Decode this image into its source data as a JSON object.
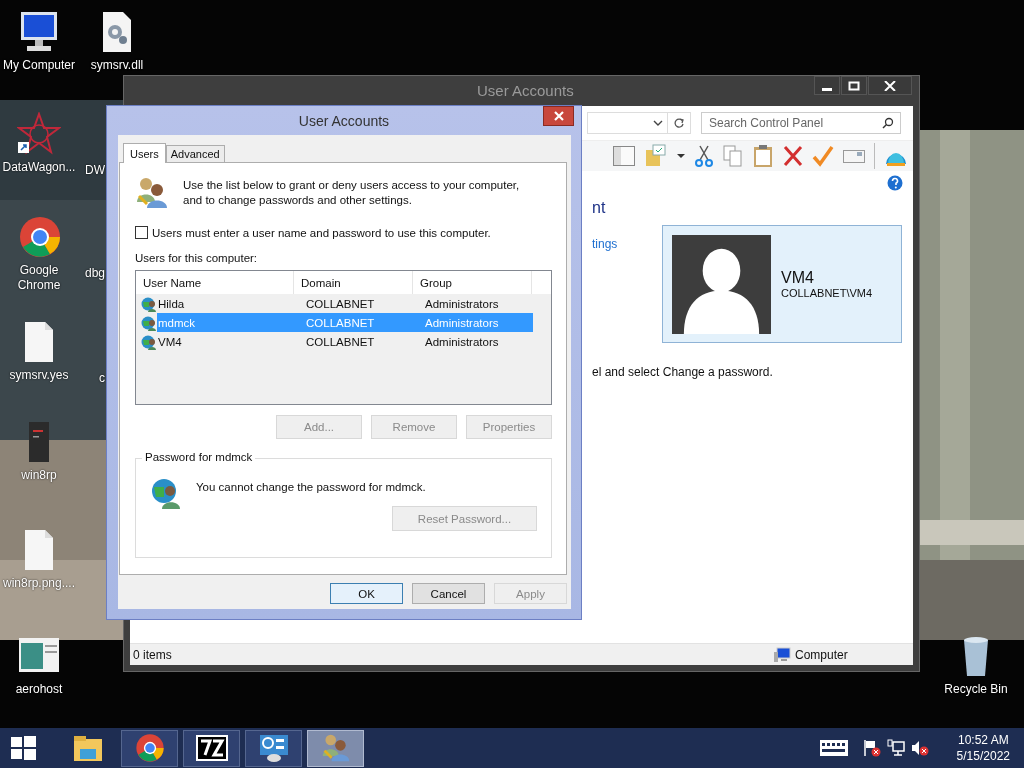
{
  "desktop": {
    "icons": [
      {
        "label": "My Computer",
        "kind": "computer"
      },
      {
        "label": "symsrv.dll",
        "kind": "settings-file"
      },
      {
        "label": "DataWagon...",
        "kind": "star-shortcut"
      },
      {
        "label": "DW",
        "kind": "hidden"
      },
      {
        "label": "Google Chrome",
        "kind": "chrome"
      },
      {
        "label": "dbg",
        "kind": "hidden"
      },
      {
        "label": "symsrv.yes",
        "kind": "file"
      },
      {
        "label": "c",
        "kind": "hidden"
      },
      {
        "label": "win8rp",
        "kind": "book"
      },
      {
        "label": "win8rp.png....",
        "kind": "file"
      },
      {
        "label": "aerohost",
        "kind": "app-window"
      },
      {
        "label": "Recycle Bin",
        "kind": "bin"
      }
    ]
  },
  "back_window": {
    "title": "User Accounts",
    "search": {
      "placeholder": "Search Control Panel"
    },
    "heading": "nt",
    "link": "tings",
    "user_card": {
      "name": "VM4",
      "account": "COLLABNET\\VM4"
    },
    "hint": "el and select Change a password.",
    "status_bar": {
      "items": "0 items",
      "location": "Computer"
    }
  },
  "dialog": {
    "title": "User Accounts",
    "tabs": [
      {
        "label": "Users",
        "selected": true
      },
      {
        "label": "Advanced",
        "selected": false
      }
    ],
    "intro": "Use the list below to grant or deny users access to your computer,\nand to change passwords and other settings.",
    "require_login": {
      "label": "Users must enter a user name and password to use this computer.",
      "checked": false
    },
    "users_label": "Users for this computer:",
    "table": {
      "columns": [
        "User Name",
        "Domain",
        "Group"
      ],
      "rows": [
        {
          "cells": [
            "Hilda",
            "COLLABNET",
            "Administrators"
          ],
          "selected": false
        },
        {
          "cells": [
            "mdmck",
            "COLLABNET",
            "Administrators"
          ],
          "selected": true
        },
        {
          "cells": [
            "VM4",
            "COLLABNET",
            "Administrators"
          ],
          "selected": false
        }
      ]
    },
    "list_buttons": [
      {
        "label": "Add...",
        "disabled": true
      },
      {
        "label": "Remove",
        "disabled": true
      },
      {
        "label": "Properties",
        "disabled": true
      }
    ],
    "password": {
      "title": "Password for mdmck",
      "message": "You cannot change the password for mdmck.",
      "button": {
        "label": "Reset Password...",
        "disabled": true
      }
    },
    "buttons": [
      {
        "label": "OK",
        "disabled": false,
        "default": true
      },
      {
        "label": "Cancel",
        "disabled": false,
        "default": false
      },
      {
        "label": "Apply",
        "disabled": true,
        "default": false
      }
    ]
  },
  "taskbar": {
    "apps": [
      {
        "kind": "explorer",
        "running": false,
        "selected": false
      },
      {
        "kind": "chrome",
        "running": true,
        "selected": false
      },
      {
        "kind": "archive",
        "running": true,
        "selected": false
      },
      {
        "kind": "control-panel",
        "running": true,
        "selected": false
      },
      {
        "kind": "users",
        "running": true,
        "selected": true
      }
    ],
    "clock": {
      "time": "10:52 AM",
      "date": "5/15/2022"
    }
  }
}
